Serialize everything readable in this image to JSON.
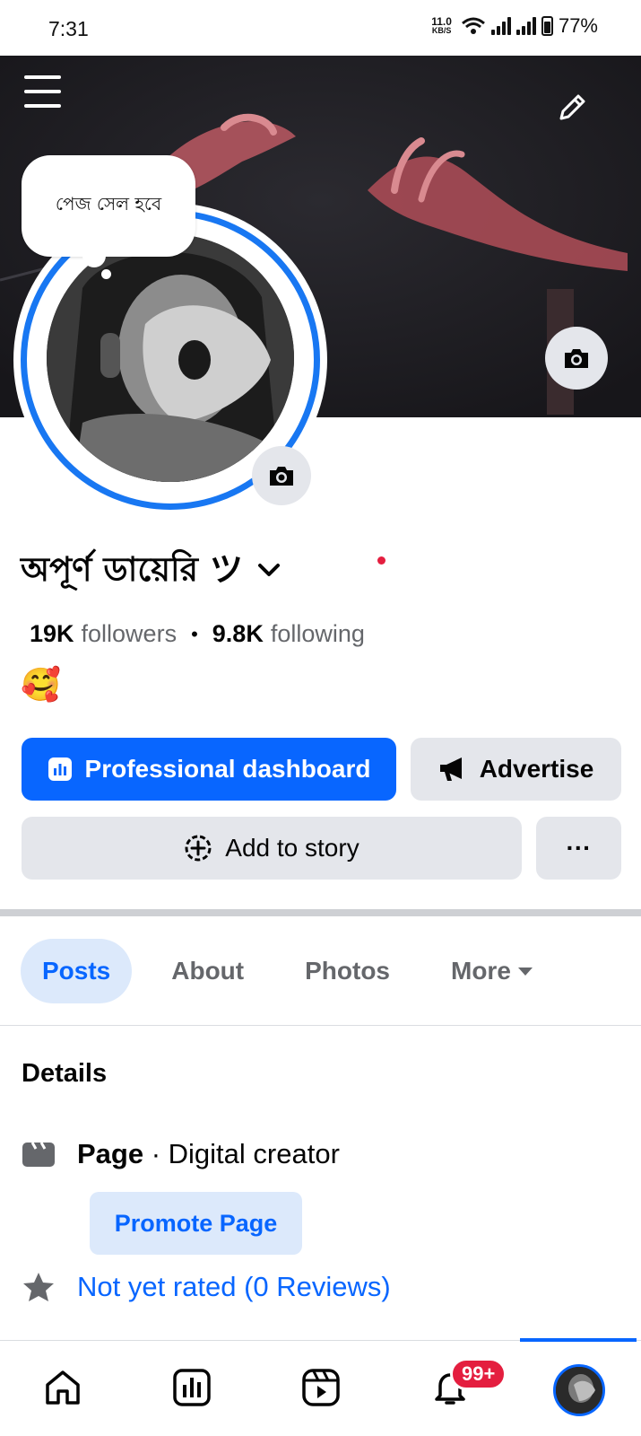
{
  "status_bar": {
    "time": "7:31",
    "speed_value": "11.0",
    "speed_unit": "KB/S",
    "battery": "77%"
  },
  "cover": {
    "note_text": "পেজ সেল হবে"
  },
  "profile": {
    "name": "অপূর্ণ ডায়েরি ツ",
    "followers_count": "19K",
    "followers_label": "followers",
    "following_count": "9.8K",
    "following_label": "following",
    "bio_emoji": "🥰"
  },
  "actions": {
    "dashboard_label": "Professional dashboard",
    "advertise_label": "Advertise",
    "add_story_label": "Add to story",
    "more_label": "···"
  },
  "tabs": {
    "posts": "Posts",
    "about": "About",
    "photos": "Photos",
    "more": "More"
  },
  "details": {
    "title": "Details",
    "page_type": "Page",
    "page_category": " · Digital creator",
    "promote_label": "Promote Page",
    "rating_text": "Not yet rated (0 Reviews)"
  },
  "bottom_nav": {
    "notification_badge": "99+"
  },
  "colors": {
    "accent": "#0866ff",
    "badge": "#e41e3f",
    "surface": "#e4e6eb"
  }
}
